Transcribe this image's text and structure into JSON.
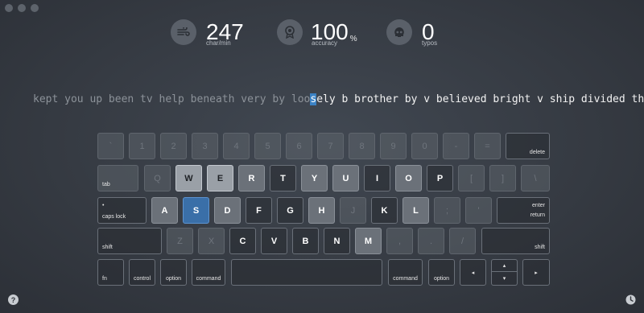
{
  "stats": {
    "speed": {
      "value": "247",
      "label": "char/min",
      "icon": "wind-icon"
    },
    "accuracy": {
      "value": "100",
      "unit": "%",
      "label": "accuracy",
      "icon": "medal-icon"
    },
    "typos": {
      "value": "0",
      "label": "typos",
      "icon": "skull-icon"
    }
  },
  "text": {
    "typed": "kept you up been tv help beneath very by loo",
    "current": "s",
    "remaining": "ely b brother by v believed bright v ship divided think"
  },
  "keyboard": {
    "row1": [
      "`",
      "1",
      "2",
      "3",
      "4",
      "5",
      "6",
      "7",
      "8",
      "9",
      "0",
      "-",
      "=",
      "delete"
    ],
    "row2": [
      "tab",
      "Q",
      "W",
      "E",
      "R",
      "T",
      "Y",
      "U",
      "I",
      "O",
      "P",
      "[",
      "]",
      "\\"
    ],
    "row3": [
      "caps lock",
      "A",
      "S",
      "D",
      "F",
      "G",
      "H",
      "J",
      "K",
      "L",
      ";",
      "'",
      "enter",
      "return"
    ],
    "row4": [
      "shift",
      "Z",
      "X",
      "C",
      "V",
      "B",
      "N",
      "M",
      ",",
      ".",
      "/",
      "shift"
    ],
    "row5": [
      "fn",
      "control",
      "option",
      "command",
      "",
      "command",
      "option",
      "◂",
      "▴",
      "▾",
      "▸"
    ],
    "target_key": "S"
  },
  "footer": {
    "help": "?"
  },
  "colors": {
    "accent": "#3b82c4",
    "background": "#363b43"
  }
}
